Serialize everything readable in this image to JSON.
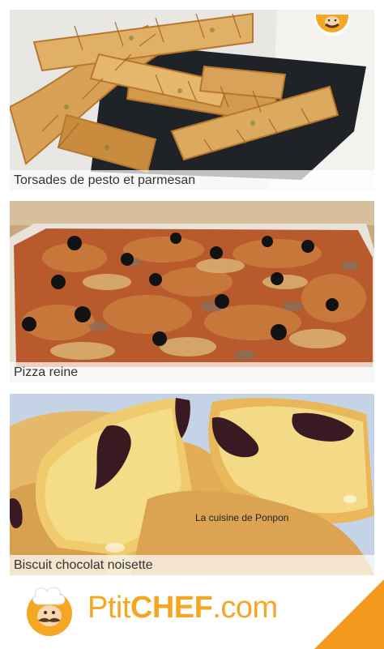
{
  "recipes": [
    {
      "caption": "Torsades de pesto et parmesan"
    },
    {
      "caption": "Pizza reine"
    },
    {
      "caption": "Biscuit chocolat noisette",
      "watermark": "La cuisine de Ponpon"
    }
  ],
  "footer": {
    "brand_ptit": "Ptit",
    "brand_chef": "CHEF",
    "brand_com": ".com",
    "accent_color": "#f5a623"
  },
  "icons": {
    "top_logo": "chef-mascot-icon",
    "footer_logo": "chef-mascot-icon"
  }
}
